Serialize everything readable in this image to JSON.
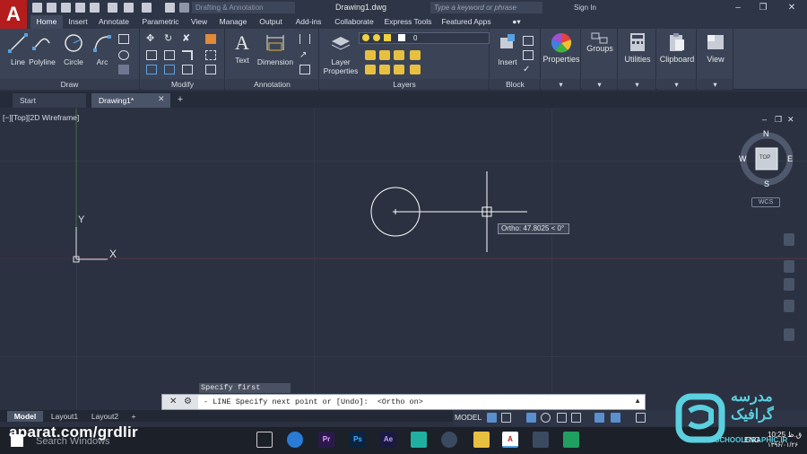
{
  "app": {
    "logo_letter": "A",
    "workspace": "Drafting & Annotation",
    "document_title": "Drawing1.dwg",
    "search_placeholder": "Type a keyword or phrase",
    "sign_in": "Sign In"
  },
  "ribbon_tabs": [
    "Home",
    "Insert",
    "Annotate",
    "Parametric",
    "View",
    "Manage",
    "Output",
    "Add-ins",
    "Collaborate",
    "Express Tools",
    "Featured Apps"
  ],
  "ribbon": {
    "draw": {
      "title": "Draw",
      "line": "Line",
      "polyline": "Polyline",
      "circle": "Circle",
      "arc": "Arc"
    },
    "modify": {
      "title": "Modify"
    },
    "annotation": {
      "title": "Annotation",
      "text": "Text",
      "dimension": "Dimension"
    },
    "layers": {
      "title": "Layers",
      "layer_properties_line1": "Layer",
      "layer_properties_line2": "Properties",
      "current_layer": "0"
    },
    "block": {
      "title": "Block",
      "insert": "Insert"
    },
    "properties": "Properties",
    "groups": "Groups",
    "utilities": "Utilities",
    "clipboard": "Clipboard",
    "view": "View"
  },
  "doc_tabs": {
    "start": "Start",
    "drawing": "Drawing1*",
    "add": "+"
  },
  "viewport": {
    "label": "[−][Top][2D Wireframe]",
    "compass": {
      "n": "N",
      "s": "S",
      "e": "E",
      "w": "W",
      "top": "TOP"
    },
    "wcs": "WCS",
    "ucs_x": "X",
    "ucs_y": "Y"
  },
  "tooltip": "Ortho: 47.8025 < 0°",
  "command": {
    "history": "Specify first point:",
    "prompt": "- LINE Specify next point or [Undo]:  <Ortho on>"
  },
  "layout_tabs": {
    "model": "Model",
    "layout1": "Layout1",
    "layout2": "Layout2",
    "add": "+"
  },
  "status": {
    "model": "MODEL"
  },
  "taskbar": {
    "watermark": "aparat.com/grdlir",
    "search": "Search Windows",
    "apps": [
      "Pr",
      "Ps",
      "Ae"
    ],
    "lang": "ENG",
    "time": "10:25 ق.ظ",
    "date": "۱۳۹۶/۰۱/۲۶"
  },
  "branding": {
    "school_en": "SCHOOLGRAPHIC.IR",
    "school_fa": "مدرسه گرافیک"
  },
  "colors": {
    "accent_red": "#b51c1c",
    "canvas": "#2b3140",
    "ribbon": "#3b4456"
  }
}
